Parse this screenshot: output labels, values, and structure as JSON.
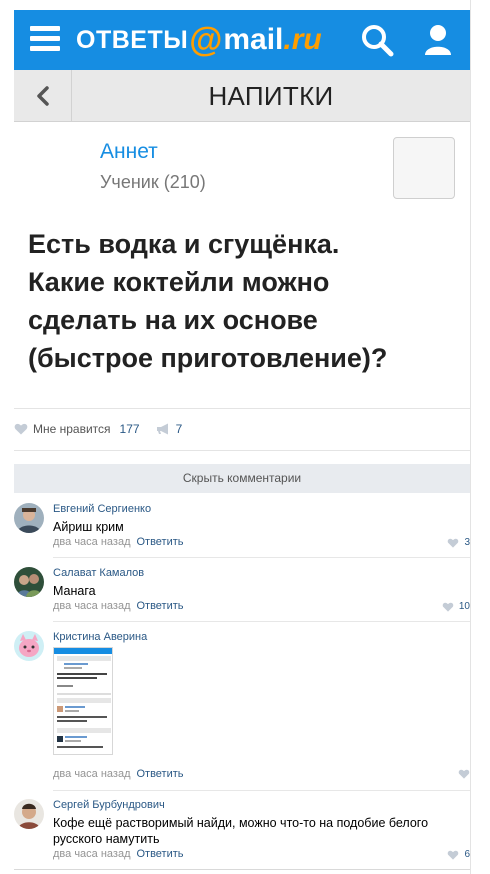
{
  "header": {
    "logo_part1": "ОТВЕТЫ",
    "logo_at": "@",
    "logo_part2": "mail",
    "logo_part3": ".ru",
    "brand_color": "#168de2",
    "accent_color": "#ff9e00"
  },
  "category": {
    "title": "НАПИТКИ"
  },
  "author": {
    "name": "Аннет",
    "rank": "Ученик (210)"
  },
  "question": {
    "lines": [
      "Есть водка и сгущёнка.",
      "Какие коктейли можно",
      "сделать на их основе",
      "(быстрое приготовление)?"
    ]
  },
  "actions": {
    "like_label": "Мне нравится",
    "like_count": "177",
    "share_count": "7"
  },
  "comments_toggle": "Скрыть комментарии",
  "comments": [
    {
      "name": "Евгений Сергиенко",
      "text": "Айриш крим",
      "time": "два часа назад",
      "reply": "Ответить",
      "likes": "3"
    },
    {
      "name": "Салават Камалов",
      "text": "Манага",
      "time": "два часа назад",
      "reply": "Ответить",
      "likes": "10"
    },
    {
      "name": "Кристина Аверина",
      "text": "",
      "time": "два часа назад",
      "reply": "Ответить",
      "likes": ""
    },
    {
      "name": "Сергей Бурбундрович",
      "text_lines": [
        "Кофе ещё растворимый найди, можно что-то на подобие белого",
        "русского намутить"
      ],
      "time": "два часа назад",
      "reply": "Ответить",
      "likes": "6"
    }
  ]
}
